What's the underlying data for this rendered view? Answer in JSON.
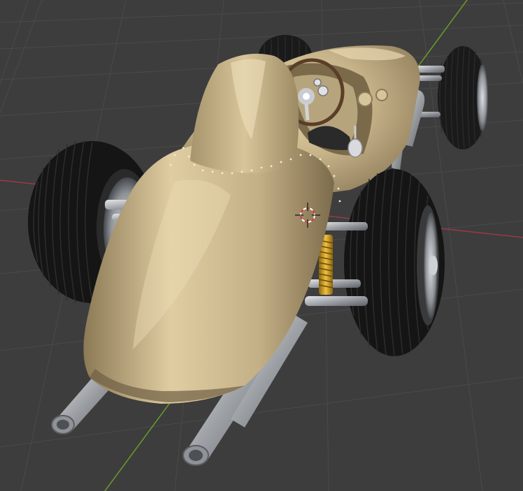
{
  "viewport": {
    "background": "#3d3d3d",
    "grid_line_color": "#4a4a4a",
    "x_axis_color": "#9a3b44",
    "y_axis_color": "#6c9a2a",
    "view": "perspective"
  },
  "scene": {
    "object": "vintage-race-car",
    "body_color": "#c8b48a",
    "tire_color": "#1a1a1a",
    "chrome_color": "#b9bcc0",
    "spring_color": "#c89a1e"
  },
  "cursor_3d": {
    "icon": "3d-cursor-icon",
    "ring_colors": [
      "#d83a3a",
      "#ffffff"
    ]
  }
}
